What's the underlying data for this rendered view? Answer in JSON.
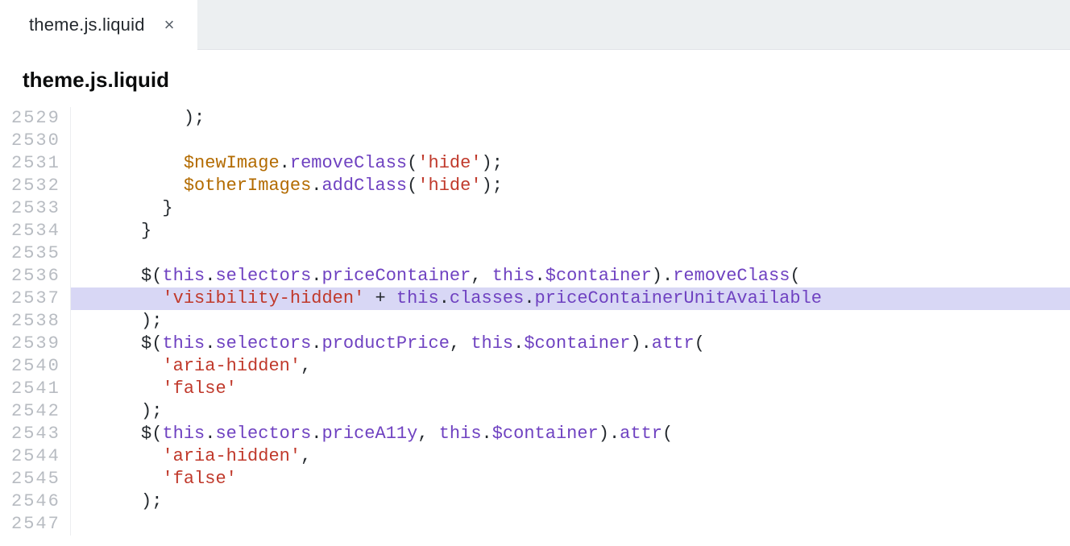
{
  "tab": {
    "label": "theme.js.liquid",
    "close_glyph": "×"
  },
  "file_header": "theme.js.liquid",
  "gutter": {
    "start": 2529,
    "end": 2547
  },
  "highlighted_line": 2537,
  "code_lines": [
    {
      "n": 2529,
      "tokens": [
        {
          "t": "          );",
          "c": "plain"
        }
      ]
    },
    {
      "n": 2530,
      "tokens": [
        {
          "t": "",
          "c": "plain"
        }
      ]
    },
    {
      "n": 2531,
      "tokens": [
        {
          "t": "          ",
          "c": "plain"
        },
        {
          "t": "$newImage",
          "c": "jq"
        },
        {
          "t": ".",
          "c": "plain"
        },
        {
          "t": "removeClass",
          "c": "ident"
        },
        {
          "t": "(",
          "c": "plain"
        },
        {
          "t": "'hide'",
          "c": "string"
        },
        {
          "t": ");",
          "c": "plain"
        }
      ]
    },
    {
      "n": 2532,
      "tokens": [
        {
          "t": "          ",
          "c": "plain"
        },
        {
          "t": "$otherImages",
          "c": "jq"
        },
        {
          "t": ".",
          "c": "plain"
        },
        {
          "t": "addClass",
          "c": "ident"
        },
        {
          "t": "(",
          "c": "plain"
        },
        {
          "t": "'hide'",
          "c": "string"
        },
        {
          "t": ");",
          "c": "plain"
        }
      ]
    },
    {
      "n": 2533,
      "tokens": [
        {
          "t": "        }",
          "c": "plain"
        }
      ]
    },
    {
      "n": 2534,
      "tokens": [
        {
          "t": "      }",
          "c": "plain"
        }
      ]
    },
    {
      "n": 2535,
      "tokens": [
        {
          "t": "",
          "c": "plain"
        }
      ]
    },
    {
      "n": 2536,
      "tokens": [
        {
          "t": "      ",
          "c": "plain"
        },
        {
          "t": "$",
          "c": "plain"
        },
        {
          "t": "(",
          "c": "plain"
        },
        {
          "t": "this",
          "c": "ident"
        },
        {
          "t": ".",
          "c": "plain"
        },
        {
          "t": "selectors",
          "c": "ident"
        },
        {
          "t": ".",
          "c": "plain"
        },
        {
          "t": "priceContainer",
          "c": "ident"
        },
        {
          "t": ", ",
          "c": "plain"
        },
        {
          "t": "this",
          "c": "ident"
        },
        {
          "t": ".",
          "c": "plain"
        },
        {
          "t": "$container",
          "c": "ident"
        },
        {
          "t": ").",
          "c": "plain"
        },
        {
          "t": "removeClass",
          "c": "ident"
        },
        {
          "t": "(",
          "c": "plain"
        }
      ]
    },
    {
      "n": 2537,
      "tokens": [
        {
          "t": "        ",
          "c": "plain"
        },
        {
          "t": "'visibility-hidden'",
          "c": "string"
        },
        {
          "t": " + ",
          "c": "plain"
        },
        {
          "t": "this",
          "c": "ident"
        },
        {
          "t": ".",
          "c": "plain"
        },
        {
          "t": "classes",
          "c": "ident"
        },
        {
          "t": ".",
          "c": "plain"
        },
        {
          "t": "priceContainerUnitAvailable",
          "c": "ident"
        }
      ]
    },
    {
      "n": 2538,
      "tokens": [
        {
          "t": "      );",
          "c": "plain"
        }
      ]
    },
    {
      "n": 2539,
      "tokens": [
        {
          "t": "      ",
          "c": "plain"
        },
        {
          "t": "$",
          "c": "plain"
        },
        {
          "t": "(",
          "c": "plain"
        },
        {
          "t": "this",
          "c": "ident"
        },
        {
          "t": ".",
          "c": "plain"
        },
        {
          "t": "selectors",
          "c": "ident"
        },
        {
          "t": ".",
          "c": "plain"
        },
        {
          "t": "productPrice",
          "c": "ident"
        },
        {
          "t": ", ",
          "c": "plain"
        },
        {
          "t": "this",
          "c": "ident"
        },
        {
          "t": ".",
          "c": "plain"
        },
        {
          "t": "$container",
          "c": "ident"
        },
        {
          "t": ").",
          "c": "plain"
        },
        {
          "t": "attr",
          "c": "ident"
        },
        {
          "t": "(",
          "c": "plain"
        }
      ]
    },
    {
      "n": 2540,
      "tokens": [
        {
          "t": "        ",
          "c": "plain"
        },
        {
          "t": "'aria-hidden'",
          "c": "string"
        },
        {
          "t": ",",
          "c": "plain"
        }
      ]
    },
    {
      "n": 2541,
      "tokens": [
        {
          "t": "        ",
          "c": "plain"
        },
        {
          "t": "'false'",
          "c": "string"
        }
      ]
    },
    {
      "n": 2542,
      "tokens": [
        {
          "t": "      );",
          "c": "plain"
        }
      ]
    },
    {
      "n": 2543,
      "tokens": [
        {
          "t": "      ",
          "c": "plain"
        },
        {
          "t": "$",
          "c": "plain"
        },
        {
          "t": "(",
          "c": "plain"
        },
        {
          "t": "this",
          "c": "ident"
        },
        {
          "t": ".",
          "c": "plain"
        },
        {
          "t": "selectors",
          "c": "ident"
        },
        {
          "t": ".",
          "c": "plain"
        },
        {
          "t": "priceA11y",
          "c": "ident"
        },
        {
          "t": ", ",
          "c": "plain"
        },
        {
          "t": "this",
          "c": "ident"
        },
        {
          "t": ".",
          "c": "plain"
        },
        {
          "t": "$container",
          "c": "ident"
        },
        {
          "t": ").",
          "c": "plain"
        },
        {
          "t": "attr",
          "c": "ident"
        },
        {
          "t": "(",
          "c": "plain"
        }
      ]
    },
    {
      "n": 2544,
      "tokens": [
        {
          "t": "        ",
          "c": "plain"
        },
        {
          "t": "'aria-hidden'",
          "c": "string"
        },
        {
          "t": ",",
          "c": "plain"
        }
      ]
    },
    {
      "n": 2545,
      "tokens": [
        {
          "t": "        ",
          "c": "plain"
        },
        {
          "t": "'false'",
          "c": "string"
        }
      ]
    },
    {
      "n": 2546,
      "tokens": [
        {
          "t": "      );",
          "c": "plain"
        }
      ]
    },
    {
      "n": 2547,
      "tokens": [
        {
          "t": "",
          "c": "plain"
        }
      ]
    }
  ]
}
